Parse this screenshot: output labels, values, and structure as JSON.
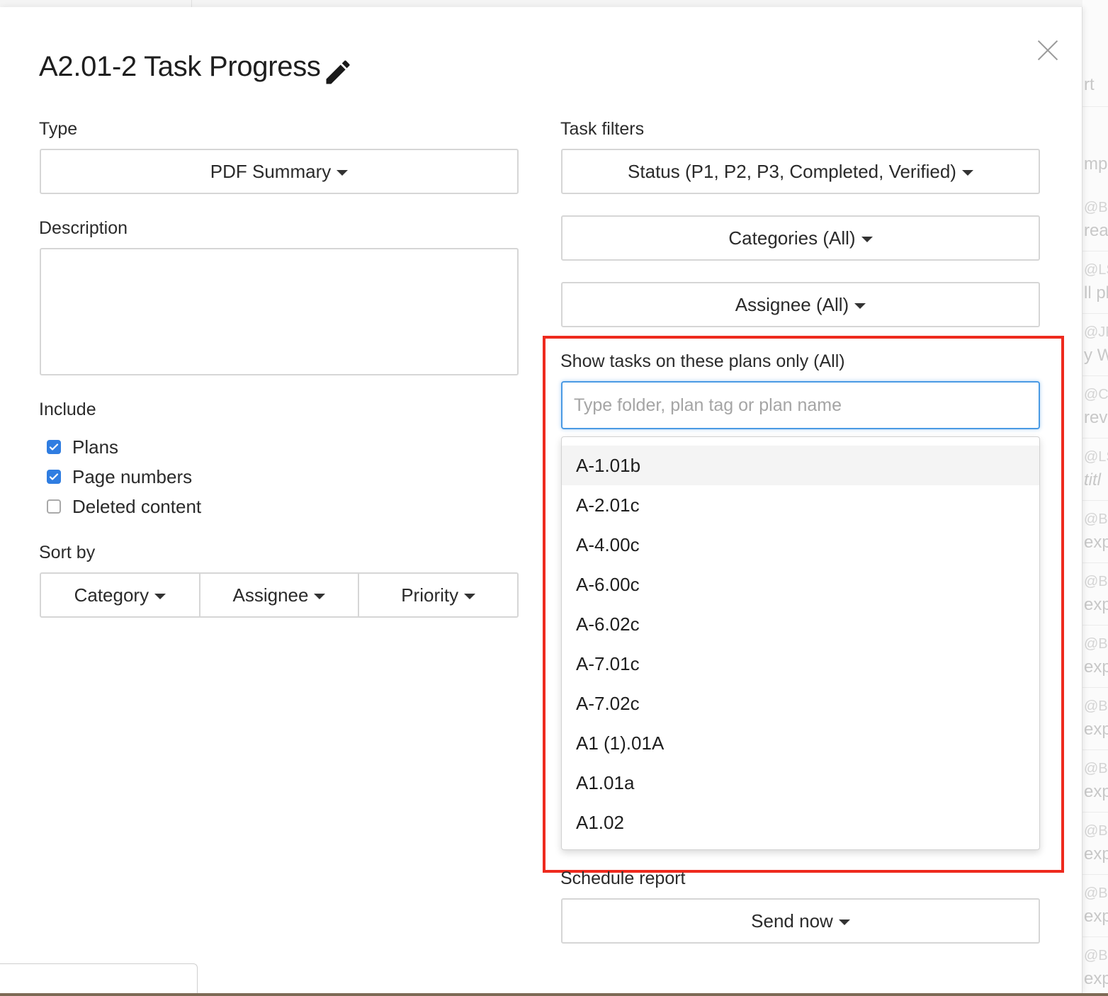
{
  "dialog": {
    "title": "A2.01-2 Task Progress",
    "edit_icon": "pencil-icon",
    "close_icon": "close-icon"
  },
  "type": {
    "label": "Type",
    "value": "PDF Summary"
  },
  "description": {
    "label": "Description",
    "value": ""
  },
  "include": {
    "label": "Include",
    "items": [
      {
        "label": "Plans",
        "checked": true
      },
      {
        "label": "Page numbers",
        "checked": true
      },
      {
        "label": "Deleted content",
        "checked": false
      }
    ]
  },
  "sort": {
    "label": "Sort by",
    "options": [
      "Category",
      "Assignee",
      "Priority"
    ]
  },
  "task_filters": {
    "label": "Task filters",
    "status": "Status (P1, P2, P3, Completed, Verified)",
    "categories": "Categories (All)",
    "assignee": "Assignee (All)"
  },
  "plans_filter": {
    "label": "Show tasks on these plans only (All)",
    "placeholder": "Type folder, plan tag or plan name",
    "value": "",
    "options": [
      "A-1.01b",
      "A-2.01c",
      "A-4.00c",
      "A-6.00c",
      "A-6.02c",
      "A-7.01c",
      "A-7.02c",
      "A1 (1).01A",
      "A1.01a",
      "A1.02"
    ],
    "active_index": 0
  },
  "schedule": {
    "label": "Schedule report",
    "value": "Send now"
  },
  "colors": {
    "accent": "#2f7de1",
    "focus": "#4a9ae4",
    "highlight": "#ee2a1e"
  },
  "background_fragments": [
    "rt",
    "mpl",
    "@B",
    "rea",
    "@LS",
    "ll pl",
    "@JF",
    "y W",
    "@C",
    "revi",
    "@LS",
    "titl",
    "@B",
    "expo",
    "@B",
    "expo",
    "@B",
    "expo",
    "@B",
    "expo",
    "@B",
    "expo",
    "@B",
    "expo",
    "@B",
    "expo",
    "@B",
    "expo"
  ]
}
